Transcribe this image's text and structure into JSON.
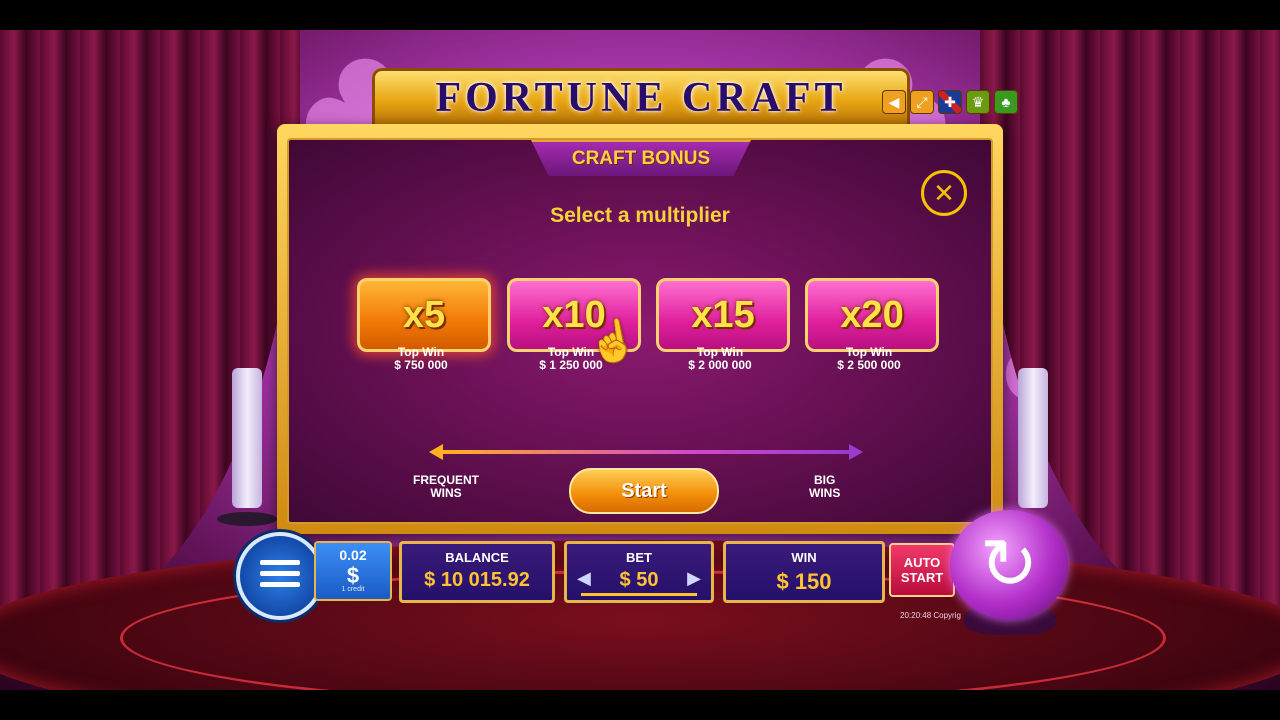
{
  "game": {
    "title": "FORTUNE CRAFT",
    "top_icons": [
      "sound-icon",
      "fullscreen-icon",
      "language-flag-icon",
      "trophy-icon",
      "settings-icon"
    ]
  },
  "bonus": {
    "title": "CRAFT BONUS",
    "prompt": "Select a multiplier",
    "close_symbol": "✕",
    "options": [
      {
        "label": "x5",
        "cap_label": "Top Win",
        "top_win": "$ 750 000"
      },
      {
        "label": "x10",
        "cap_label": "Top Win",
        "top_win": "$ 1 250 000"
      },
      {
        "label": "x15",
        "cap_label": "Top Win",
        "top_win": "$ 2 000 000"
      },
      {
        "label": "x20",
        "cap_label": "Top Win",
        "top_win": "$ 2 500 000"
      }
    ],
    "scale_left": "FREQUENT\nWINS",
    "scale_right": "BIG\nWINS",
    "start_label": "Start"
  },
  "bottom_bar": {
    "credit_value": "0.02",
    "credit_symbol": "$",
    "credit_caption": "1 credit",
    "balance_label": "BALANCE",
    "balance_value": "$ 10 015.92",
    "bet_label": "BET",
    "bet_value": "$ 50",
    "bet_prev": "◀",
    "bet_next": "▶",
    "win_label": "WIN",
    "win_value": "$ 150",
    "auto_start_label": "AUTO\nSTART",
    "spin_symbol": "↻",
    "time": "20:20:48",
    "copyright": "Copyrig"
  },
  "colors": {
    "gold": "#ffc233",
    "panel": "#5e0e4c",
    "orange_button": "#f27a06",
    "pink_button": "#e0209e"
  }
}
